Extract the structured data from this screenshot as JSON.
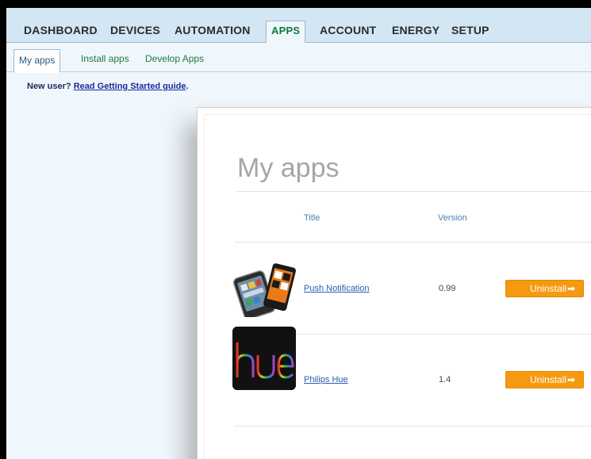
{
  "nav": {
    "items": [
      "DASHBOARD",
      "DEVICES",
      "AUTOMATION",
      "APPS",
      "ACCOUNT",
      "ENERGY",
      "SETUP"
    ],
    "active": "APPS"
  },
  "subnav": {
    "items": [
      "My apps",
      "Install apps",
      "Develop Apps"
    ],
    "active": "My apps"
  },
  "newuser": {
    "prefix": "New user? ",
    "link": "Read Getting Started guide",
    "suffix": "."
  },
  "modal": {
    "title": "My apps",
    "columns": {
      "title": "Title",
      "version": "Version"
    },
    "apps": [
      {
        "name": "Push Notification",
        "version": "0.99",
        "action": "Uninstall",
        "icon": "phones-icon"
      },
      {
        "name": "Philips Hue",
        "version": "1.4",
        "action": "Uninstall",
        "icon": "hue-logo-icon"
      }
    ]
  },
  "colors": {
    "accent": "#f59a10",
    "nav_bg": "#d3e6f4",
    "link": "#2a5db0",
    "active_green": "#0a7a3e"
  }
}
